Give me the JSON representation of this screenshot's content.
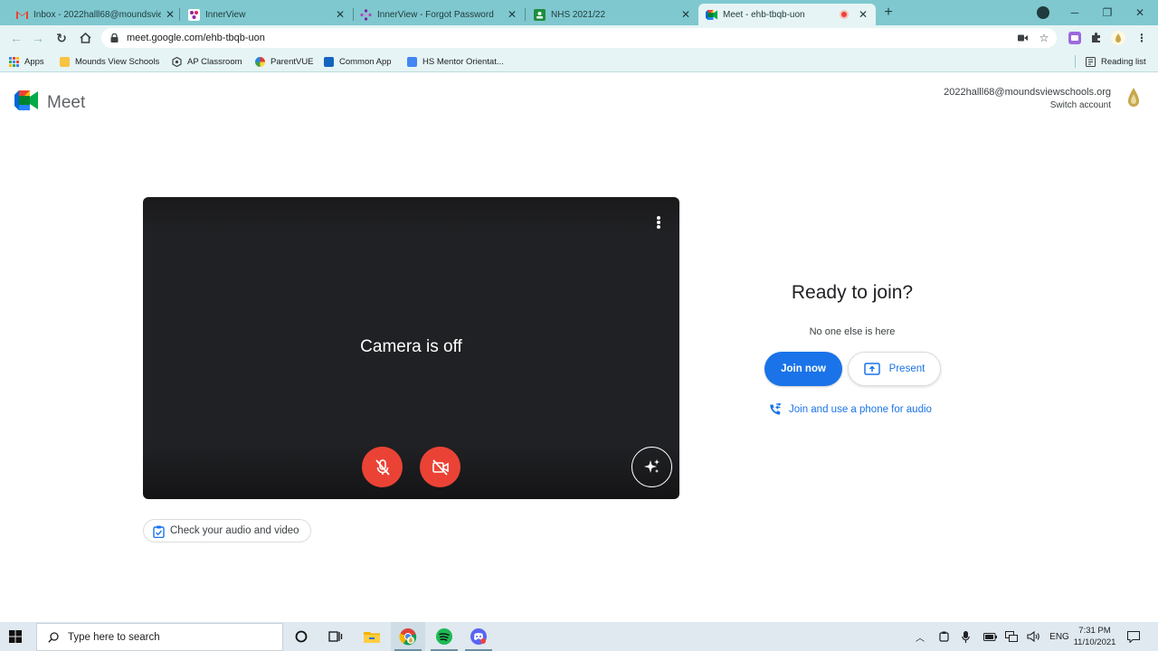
{
  "browser": {
    "tabs": [
      {
        "title": "Inbox - 2022halll68@moundsvie",
        "icon": "gmail-icon"
      },
      {
        "title": "InnerView",
        "icon": "innerview-icon"
      },
      {
        "title": "InnerView - Forgot Password",
        "icon": "innerview-star-icon"
      },
      {
        "title": "NHS 2021/22",
        "icon": "classroom-icon"
      },
      {
        "title": "Meet - ehb-tbqb-uon",
        "icon": "meet-icon",
        "active": true
      }
    ],
    "url": "meet.google.com/ehb-tbqb-uon",
    "bookmarks": [
      {
        "label": "Apps",
        "icon": "apps-grid-icon"
      },
      {
        "label": "Mounds View Schools",
        "icon": "bookmark-folder-icon"
      },
      {
        "label": "AP Classroom",
        "icon": "ap-classroom-icon"
      },
      {
        "label": "ParentVUE",
        "icon": "parentvue-icon"
      },
      {
        "label": "Common App",
        "icon": "common-app-icon"
      },
      {
        "label": "HS Mentor Orientat...",
        "icon": "google-forms-icon"
      }
    ],
    "reading_list": "Reading list"
  },
  "meet": {
    "brand": "Meet",
    "account_email": "2022halll68@moundsviewschools.org",
    "switch_account": "Switch account",
    "camera_status": "Camera is off",
    "check_av": "Check your audio and video",
    "ready_title": "Ready to join?",
    "ready_sub": "No one else is here",
    "join_label": "Join now",
    "present_label": "Present",
    "phone_label": "Join and use a phone for audio",
    "colors": {
      "accent": "#1a73e8",
      "danger": "#ea4335",
      "preview_bg": "#202124"
    }
  },
  "taskbar": {
    "search_placeholder": "Type here to search",
    "language": "ENG",
    "time": "7:31 PM",
    "date": "11/10/2021"
  }
}
